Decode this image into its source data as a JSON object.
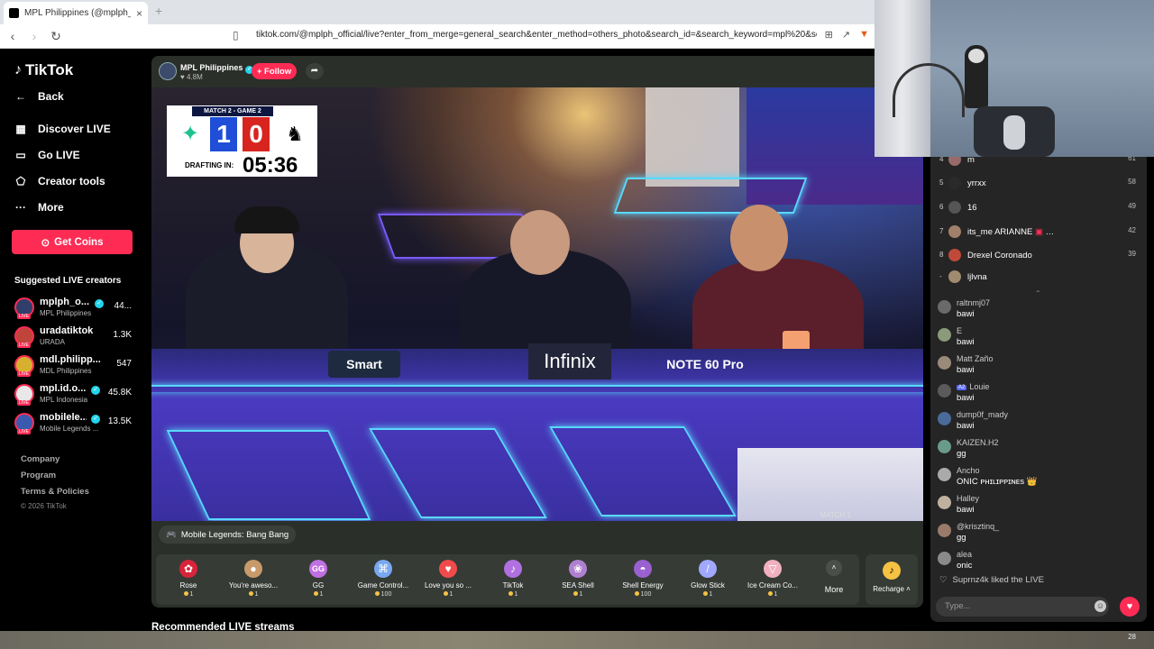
{
  "browser": {
    "tab_title": "MPL Philippines (@mplph_offi...",
    "close": "×",
    "new_tab": "+",
    "url": "tiktok.com/@mplph_official/live?enter_from_merge=general_search&enter_method=others_photo&search_id=&search_keyword=mpl%20&sear..."
  },
  "sidebar": {
    "logo": "TikTok",
    "back": "Back",
    "nav": [
      "Discover LIVE",
      "Go LIVE",
      "Creator tools",
      "More"
    ],
    "get_coins": "Get Coins",
    "suggested_title": "Suggested LIVE creators",
    "creators": [
      {
        "name": "mplph_o...",
        "sub": "MPL Philippines",
        "count": "44...",
        "verified": true
      },
      {
        "name": "uradatiktok",
        "sub": "URADA",
        "count": "1.3K",
        "verified": false
      },
      {
        "name": "mdl.philipp...",
        "sub": "MDL Philippines",
        "count": "547",
        "verified": false
      },
      {
        "name": "mpl.id.o...",
        "sub": "MPL Indonesia",
        "count": "45.8K",
        "verified": true
      },
      {
        "name": "mobilele...",
        "sub": "Mobile Legends ...",
        "count": "13.5K",
        "verified": true
      }
    ],
    "live_tag": "LIVE",
    "footer": [
      "Company",
      "Program",
      "Terms & Policies"
    ],
    "copyright": "© 2026 TikTok"
  },
  "stream": {
    "channel_name": "MPL Philippines",
    "likes": "4.8M",
    "follow_label": "+ Follow",
    "scoreboard": {
      "match": "MATCH 2 - GAME 2",
      "score_left": "1",
      "score_right": "0",
      "drafting_label": "DRAFTING IN:",
      "timer": "05:36"
    },
    "sponsors": [
      "Smart",
      "Infinix",
      "NOTE 60 Pro"
    ],
    "video_tag": "MATCH 1",
    "category": "Mobile Legends: Bang Bang"
  },
  "gifts": [
    {
      "name": "Rose",
      "price": "1",
      "icon": "rose-icon",
      "color": "#d8243a"
    },
    {
      "name": "You're aweso...",
      "price": "1",
      "icon": "hamster-icon",
      "color": "#c89a6a"
    },
    {
      "name": "GG",
      "price": "1",
      "icon": "gg-icon",
      "color": "#c070e0"
    },
    {
      "name": "Game Control...",
      "price": "100",
      "icon": "controller-icon",
      "color": "#7aa8f0"
    },
    {
      "name": "Love you so ...",
      "price": "1",
      "icon": "heart-face-icon",
      "color": "#f04a4a"
    },
    {
      "name": "TikTok",
      "price": "1",
      "icon": "tiktok-icon",
      "color": "#b070e0"
    },
    {
      "name": "SEA Shell",
      "price": "1",
      "icon": "shell-icon",
      "color": "#b080d0"
    },
    {
      "name": "Shell Energy",
      "price": "100",
      "icon": "energy-shell-icon",
      "color": "#9a60d0"
    },
    {
      "name": "Glow Stick",
      "price": "1",
      "icon": "glowstick-icon",
      "color": "#a0a8ff"
    },
    {
      "name": "Ice Cream Co...",
      "price": "1",
      "icon": "icecream-icon",
      "color": "#f0b0c0"
    }
  ],
  "gifts_more": "More",
  "recharge": "Recharge",
  "recommended_title": "Recommended LIVE streams",
  "ranking": [
    {
      "rank": "4",
      "name": "m",
      "score": "61"
    },
    {
      "rank": "5",
      "name": "yrrxx",
      "score": "58"
    },
    {
      "rank": "6",
      "name": "16",
      "score": "49"
    },
    {
      "rank": "7",
      "name": "its_me ARIANNE",
      "score": "42"
    },
    {
      "rank": "8",
      "name": "Drexel Coronado",
      "score": "39"
    },
    {
      "rank": "-",
      "name": "ljlvna",
      "score": ""
    }
  ],
  "chat": [
    {
      "user": "raltnmj07",
      "msg": "bawi",
      "badge": ""
    },
    {
      "user": "E",
      "msg": "bawi",
      "badge": ""
    },
    {
      "user": "Matt Zaño",
      "msg": "bawi",
      "badge": ""
    },
    {
      "user": "Louie",
      "msg": "bawi",
      "badge": "A2"
    },
    {
      "user": "dump0f_mady",
      "msg": "bawi",
      "badge": ""
    },
    {
      "user": "KAIZEN.H2",
      "msg": "gg",
      "badge": ""
    },
    {
      "user": "Ancho",
      "msg": "ONIC ᴘʜɪʟɪᴘᴘɪɴᴇs 👑",
      "badge": ""
    },
    {
      "user": "Halley",
      "msg": "bawi",
      "badge": ""
    },
    {
      "user": "@krisztinq_",
      "msg": "gg",
      "badge": ""
    },
    {
      "user": "alea",
      "msg": "onic",
      "badge": ""
    }
  ],
  "liked_text": "Suprnz4k liked the LIVE",
  "chat_placeholder": "Type...",
  "taskbar_date": "28"
}
